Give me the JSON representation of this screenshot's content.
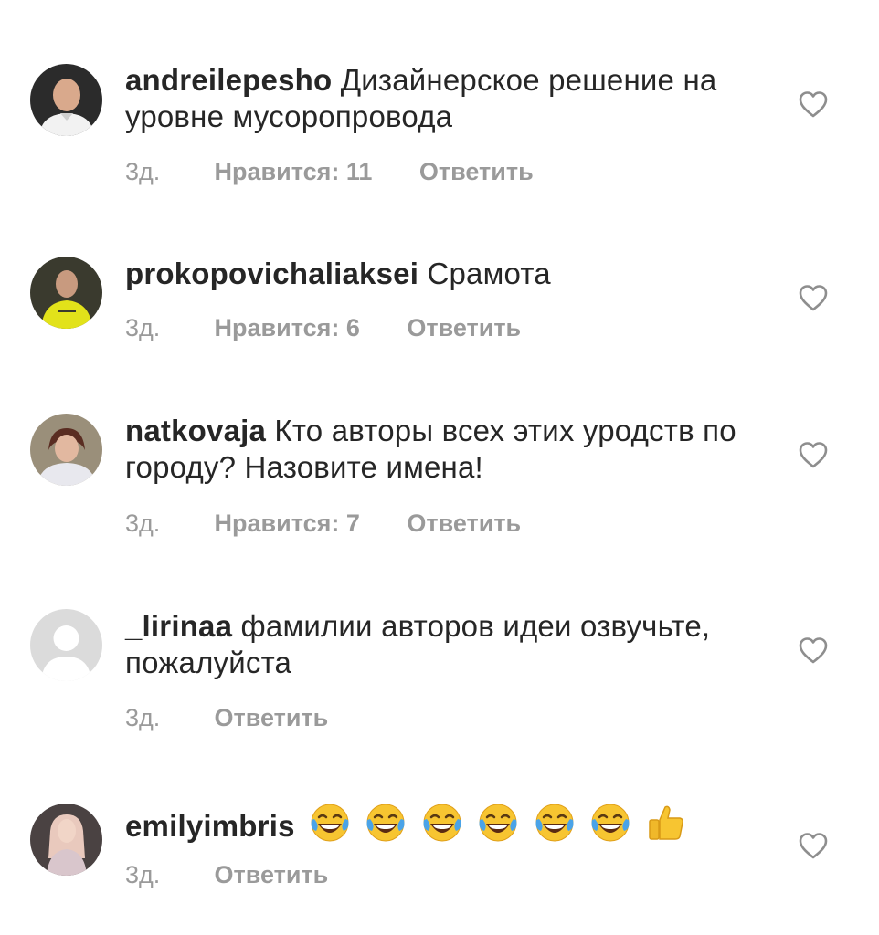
{
  "comments": [
    {
      "username": "andreilepesho",
      "text": "Дизайнерское решение на уровне мусоропровода",
      "time": "3д.",
      "likes": "Нравится: 11",
      "reply": "Ответить"
    },
    {
      "username": "prokopovichaliaksei",
      "text": "Срамота",
      "time": "3д.",
      "likes": "Нравится: 6",
      "reply": "Ответить"
    },
    {
      "username": "natkovaja",
      "text": "Кто авторы всех этих уродств по городу? Назовите имена!",
      "time": "3д.",
      "likes": "Нравится: 7",
      "reply": "Ответить"
    },
    {
      "username": "_lirinaa",
      "text": "фамилии авторов идеи озвучьте, пожалуйста",
      "time": "3д.",
      "reply": "Ответить"
    },
    {
      "username": "emilyimbris",
      "emojis": [
        "face-with-tears-of-joy",
        "face-with-tears-of-joy",
        "face-with-tears-of-joy",
        "face-with-tears-of-joy",
        "face-with-tears-of-joy",
        "face-with-tears-of-joy",
        "thumbs-up"
      ],
      "time": "3д.",
      "reply": "Ответить"
    }
  ],
  "colors": {
    "text": "#262626",
    "meta": "#9a9a9a",
    "heart": "#8e8e8e"
  }
}
